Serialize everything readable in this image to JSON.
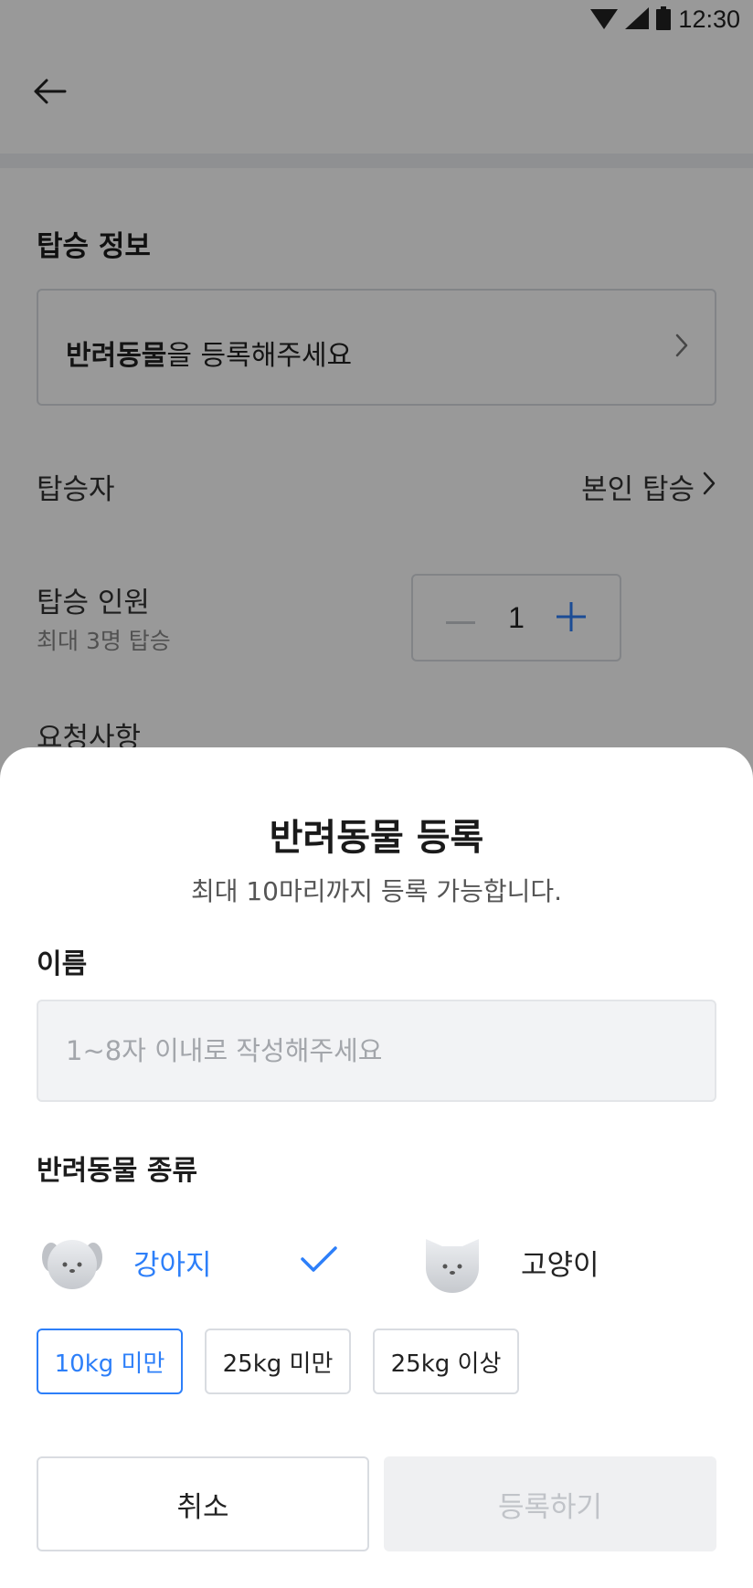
{
  "status_bar": {
    "time": "12:30",
    "icons": [
      "wifi-icon",
      "signal-icon",
      "battery-icon"
    ]
  },
  "app_bar": {
    "back_icon": "arrow-left-icon"
  },
  "background": {
    "section_title": "탑승 정보",
    "pet_card": {
      "bold_text": "반려동물",
      "rest_text": "을 등록해주세요"
    },
    "passenger": {
      "label": "탑승자",
      "value": "본인 탑승"
    },
    "passenger_count": {
      "label": "탑승 인원",
      "sub_label": "최대 3명 탑승",
      "value": "1"
    },
    "request_label": "요청사항"
  },
  "sheet": {
    "title": "반려동물 등록",
    "subtitle": "최대 10마리까지 등록 가능합니다.",
    "name_label": "이름",
    "name_placeholder": "1~8자 이내로 작성해주세요",
    "name_value": "",
    "type_label": "반려동물 종류",
    "pet_types": [
      {
        "label": "강아지",
        "selected": true,
        "icon": "dog-icon"
      },
      {
        "label": "고양이",
        "selected": false,
        "icon": "cat-icon"
      }
    ],
    "weight_options": [
      {
        "label": "10kg 미만",
        "selected": true
      },
      {
        "label": "25kg 미만",
        "selected": false
      },
      {
        "label": "25kg 이상",
        "selected": false
      }
    ],
    "cancel_label": "취소",
    "submit_label": "등록하기",
    "submit_enabled": false
  },
  "colors": {
    "accent": "#2d7ff9",
    "overlay": "rgba(0,0,0,0.40)",
    "disabled_bg": "#eff0f2",
    "disabled_text": "#c0c3c8"
  }
}
